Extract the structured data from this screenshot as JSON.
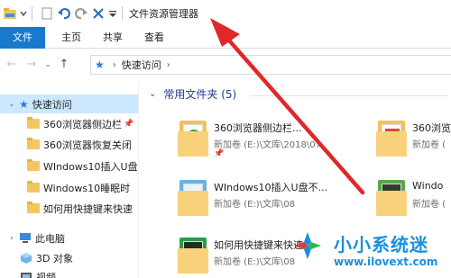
{
  "window": {
    "title": "文件资源管理器"
  },
  "ribbon": {
    "tabs": [
      "文件",
      "主页",
      "共享",
      "查看"
    ]
  },
  "address": {
    "location": "快速访问"
  },
  "navpane": {
    "quick_access_label": "快速访问",
    "pinned": [
      "360浏览器侧边栏",
      "360浏览器恢复关闭",
      "WIndows10插入U盘",
      "Windows10睡眠时",
      "如何用快捷键来快速"
    ],
    "this_pc_label": "此电脑",
    "objects3d_label": "3D 对象",
    "videos_label": "视频"
  },
  "content": {
    "group_label": "常用文件夹 (5)",
    "folders": [
      {
        "name": "360浏览器侧边栏...",
        "path": "新加卷 (E:)\\文库\\2018\\07"
      },
      {
        "name": "360浏览",
        "path": "新加卷 ("
      },
      {
        "name": "WIndows10插入U盘不...",
        "path": "新加卷 (E:)\\文库\\08"
      },
      {
        "name": "Windo",
        "path": "新加卷 ("
      },
      {
        "name": "如何用快捷键来快速...",
        "path": "新加卷 (E:)\\文库\\08"
      }
    ]
  },
  "watermark": {
    "brand": "小小系统迷",
    "url": "www.ilovext.com"
  },
  "colors": {
    "file_tab": "#1979ca",
    "selected": "#cce8ff",
    "folder": "#f3c661",
    "arrow": "#e0282a",
    "brand": "#1a8fe0"
  }
}
